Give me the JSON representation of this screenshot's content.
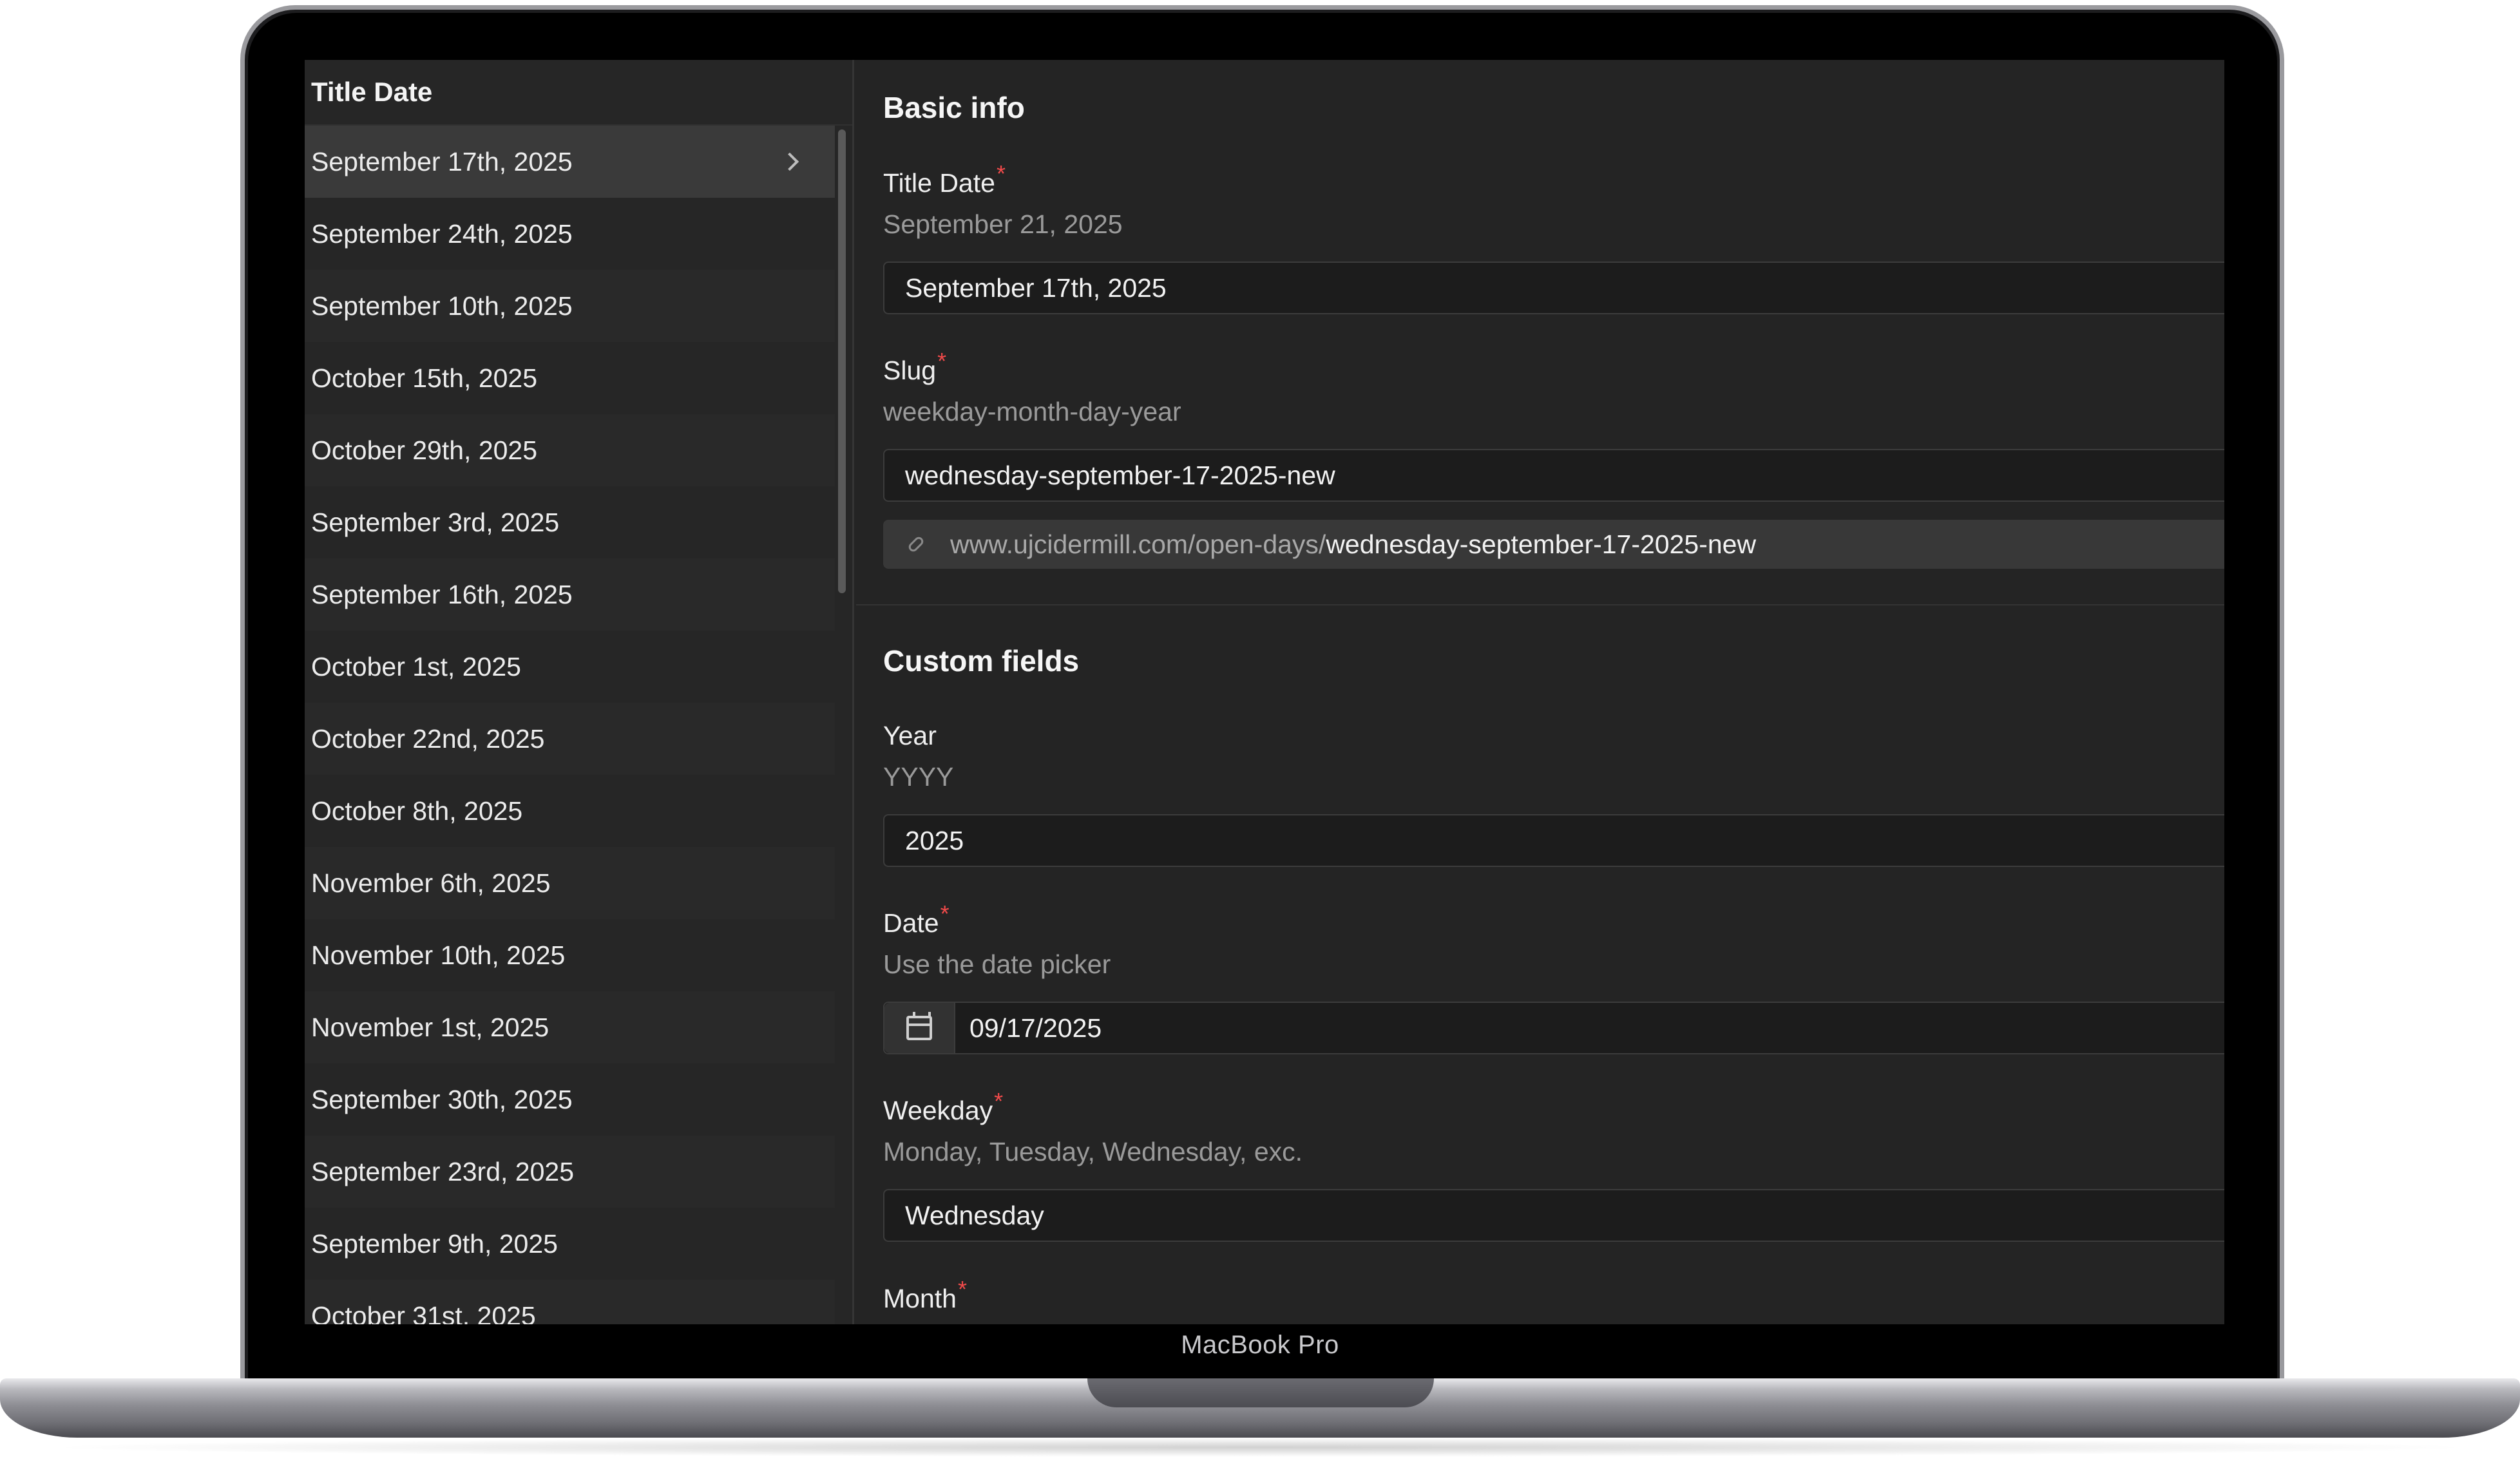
{
  "device": {
    "label": "MacBook Pro"
  },
  "list": {
    "header": "Title Date",
    "items": [
      "September 17th, 2025",
      "September 24th, 2025",
      "September 10th, 2025",
      "October 15th, 2025",
      "October 29th, 2025",
      "September 3rd, 2025",
      "September 16th, 2025",
      "October 1st, 2025",
      "October 22nd, 2025",
      "October 8th, 2025",
      "November 6th, 2025",
      "November 10th, 2025",
      "November 1st, 2025",
      "September 30th, 2025",
      "September 23rd, 2025",
      "September 9th, 2025",
      "October 31st, 2025"
    ],
    "selected_index": 0
  },
  "basic_info": {
    "title": "Basic info",
    "title_date": {
      "label": "Title Date",
      "required_mark": "*",
      "description": "September 21, 2025",
      "value": "September 17th, 2025"
    },
    "slug": {
      "label": "Slug",
      "required_mark": "*",
      "description": "weekday-month-day-year",
      "value": "wednesday-september-17-2025-new",
      "url_base": "www.ujcidermill.com/open-days/",
      "url_slug": "wednesday-september-17-2025-new",
      "url_icon": "link-icon"
    }
  },
  "custom_fields": {
    "title": "Custom fields",
    "year": {
      "label": "Year",
      "description": "YYYY",
      "value": "2025"
    },
    "date": {
      "label": "Date",
      "required_mark": "*",
      "description": "Use the date picker",
      "value": "09/17/2025",
      "icon": "calendar-icon"
    },
    "weekday": {
      "label": "Weekday",
      "required_mark": "*",
      "description": "Monday, Tuesday, Wednesday, exc.",
      "value": "Wednesday"
    },
    "month": {
      "label": "Month",
      "required_mark": "*"
    }
  },
  "colors": {
    "required": "#f04a4a",
    "background": "#242424",
    "input_background": "#1c1c1c"
  }
}
